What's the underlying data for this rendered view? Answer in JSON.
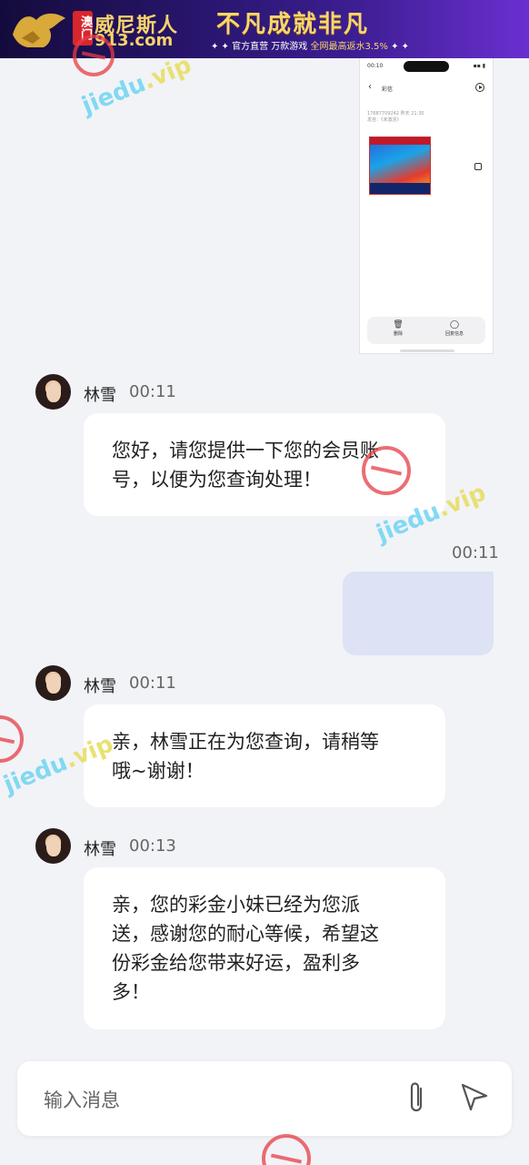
{
  "banner": {
    "badge": "澳门",
    "brand_name": "威尼斯人",
    "brand_domain": "913.com",
    "slogan": "不凡成就非凡",
    "tagline_prefix": "✦ ✦ 官方直营 万款游戏 ",
    "tagline_highlight": "全网最高返水3.5%",
    "tagline_suffix": " ✦ ✦"
  },
  "image_message": {
    "status_time": "00:10",
    "system_icons": "▪▪ ▮",
    "back_glyph": "‹",
    "title": "彩信",
    "sender_line1": "17687709242    昨天 21:30",
    "sender_line2": "发自：《未激活》",
    "delete_glyph": "🗑",
    "delete_label": "删除",
    "reply_glyph": "◯",
    "reply_label": "回复信息"
  },
  "messages": [
    {
      "sender": "林雪",
      "time": "00:11",
      "lines": [
        "您好，请您提供一下您的会员账",
        "号，以便为您查询处理！"
      ]
    },
    {
      "sender": "林雪",
      "time": "00:11",
      "lines": [
        "亲，林雪正在为您查询，请稍等",
        "哦~谢谢！"
      ]
    },
    {
      "sender": "林雪",
      "time": "00:13",
      "lines": [
        "亲，您的彩金小妹已经为您派",
        "送，感谢您的耐心等候，希望这",
        "份彩金给您带来好运，盈利多",
        "多！"
      ]
    }
  ],
  "outgoing": {
    "time": "00:11"
  },
  "composer": {
    "placeholder": "输入消息"
  },
  "watermark": {
    "text": "jiedu",
    "suffix": ".vip"
  },
  "colors": {
    "background": "#f2f3f7",
    "bubble": "#ffffff",
    "outgoing_bubble": "#dde3f4",
    "banner_gold": "#f7d36b"
  },
  "icons": [
    "back-icon",
    "play-icon",
    "save-icon",
    "delete-icon",
    "reply-icon",
    "attachment-icon",
    "send-icon"
  ]
}
